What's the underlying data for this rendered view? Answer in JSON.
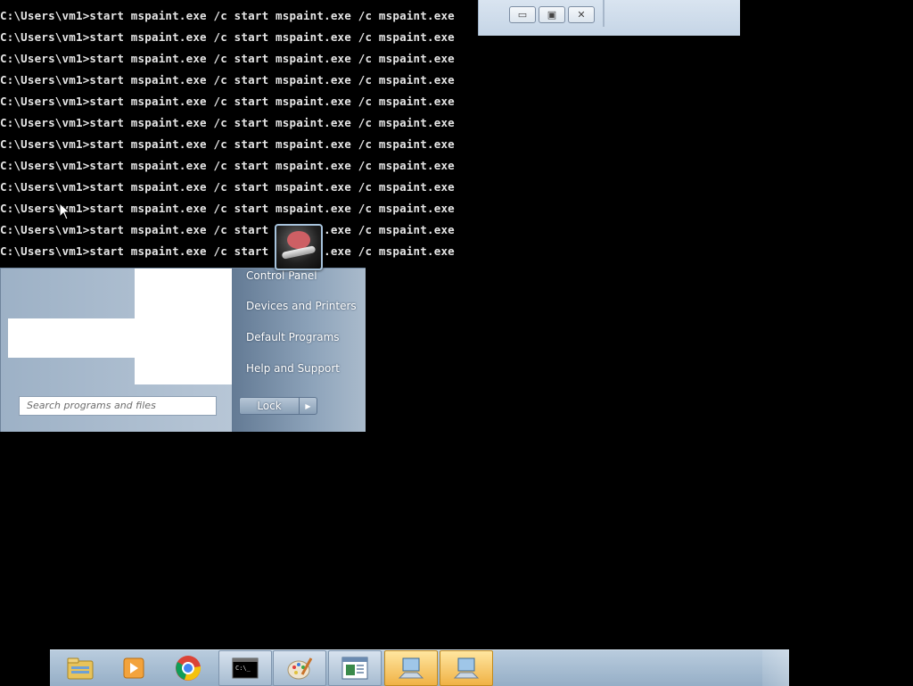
{
  "console": {
    "lines": [
      "C:\\Users\\vm1>start mspaint.exe /c start mspaint.exe /c mspaint.exe",
      "C:\\Users\\vm1>start mspaint.exe /c start mspaint.exe /c mspaint.exe",
      "C:\\Users\\vm1>start mspaint.exe /c start mspaint.exe /c mspaint.exe",
      "C:\\Users\\vm1>start mspaint.exe /c start mspaint.exe /c mspaint.exe",
      "C:\\Users\\vm1>start mspaint.exe /c start mspaint.exe /c mspaint.exe",
      "C:\\Users\\vm1>start mspaint.exe /c start mspaint.exe /c mspaint.exe",
      "C:\\Users\\vm1>start mspaint.exe /c start mspaint.exe /c mspaint.exe",
      "C:\\Users\\vm1>start mspaint.exe /c start mspaint.exe /c mspaint.exe",
      "C:\\Users\\vm1>start mspaint.exe /c start mspaint.exe /c mspaint.exe",
      "C:\\Users\\vm1>start mspaint.exe /c start mspaint.exe /c mspaint.exe",
      "C:\\Users\\vm1>start mspaint.exe /c start mspaint.exe /c mspaint.exe",
      "C:\\Users\\vm1>start mspaint.exe /c start mspaint.exe /c mspaint.exe"
    ]
  },
  "window_controls": {
    "minimize": "minimize-icon",
    "maximize": "maximize-icon",
    "close": "close-icon"
  },
  "start_menu": {
    "right_items": [
      "Control Panel",
      "Devices and Printers",
      "Default Programs",
      "Help and Support"
    ],
    "search_placeholder": "Search programs and files",
    "lock_label": "Lock"
  },
  "taskbar": {
    "items": [
      {
        "name": "windows-explorer-icon",
        "active": false,
        "boxed": false
      },
      {
        "name": "media-player-icon",
        "active": false,
        "boxed": false
      },
      {
        "name": "chrome-icon",
        "active": false,
        "boxed": false
      },
      {
        "name": "command-prompt-icon",
        "active": false,
        "boxed": true
      },
      {
        "name": "paint-icon",
        "active": false,
        "boxed": true
      },
      {
        "name": "document-window-icon",
        "active": false,
        "boxed": true
      },
      {
        "name": "network-computer-icon",
        "active": true,
        "boxed": false
      },
      {
        "name": "network-computer-icon",
        "active": true,
        "boxed": false
      }
    ]
  }
}
